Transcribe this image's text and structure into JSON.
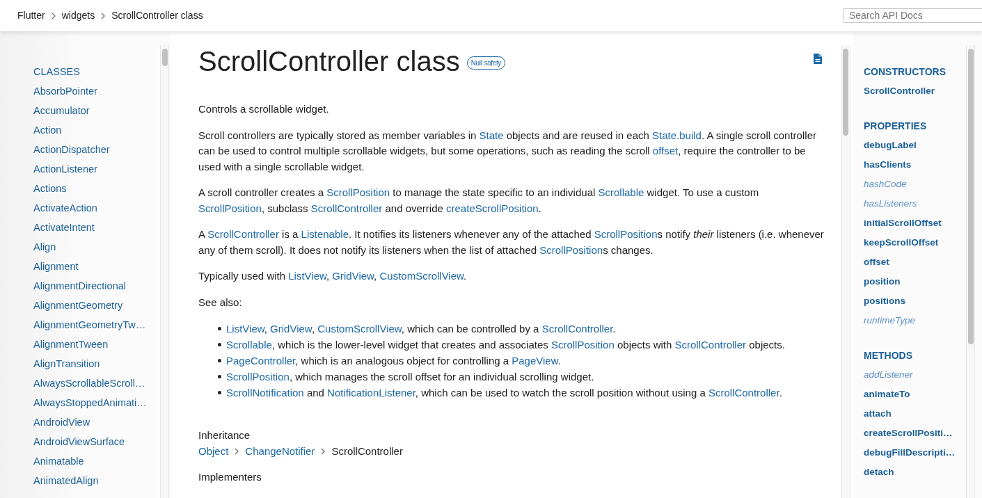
{
  "breadcrumbs": [
    {
      "label": "Flutter"
    },
    {
      "label": "widgets"
    },
    {
      "label": "ScrollController class"
    }
  ],
  "search": {
    "placeholder": "Search API Docs"
  },
  "left_sidebar": {
    "heading": "CLASSES",
    "items": [
      "AbsorbPointer",
      "Accumulator",
      "Action",
      "ActionDispatcher",
      "ActionListener",
      "Actions",
      "ActivateAction",
      "ActivateIntent",
      "Align",
      "Alignment",
      "AlignmentDirectional",
      "AlignmentGeometry",
      "AlignmentGeometryTw…",
      "AlignmentTween",
      "AlignTransition",
      "AlwaysScrollableScroll…",
      "AlwaysStoppedAnimati…",
      "AndroidView",
      "AndroidViewSurface",
      "Animatable",
      "AnimatedAlign"
    ]
  },
  "main": {
    "title": "ScrollController class",
    "badge": "Null safety",
    "paragraphs": [
      [
        {
          "kind": "text",
          "text": "Controls a scrollable widget."
        }
      ],
      [
        {
          "kind": "text",
          "text": "Scroll controllers are typically stored as member variables in "
        },
        {
          "kind": "link",
          "text": "State"
        },
        {
          "kind": "text",
          "text": " objects and are reused in each "
        },
        {
          "kind": "link",
          "text": "State.build"
        },
        {
          "kind": "text",
          "text": ". A single scroll controller can be used to control multiple scrollable widgets, but some operations, such as reading the scroll "
        },
        {
          "kind": "link",
          "text": "offset"
        },
        {
          "kind": "text",
          "text": ", require the controller to be used with a single scrollable widget."
        }
      ],
      [
        {
          "kind": "text",
          "text": "A scroll controller creates a "
        },
        {
          "kind": "link",
          "text": "ScrollPosition"
        },
        {
          "kind": "text",
          "text": " to manage the state specific to an individual "
        },
        {
          "kind": "link",
          "text": "Scrollable"
        },
        {
          "kind": "text",
          "text": " widget. To use a custom "
        },
        {
          "kind": "link",
          "text": "ScrollPosition"
        },
        {
          "kind": "text",
          "text": ", subclass "
        },
        {
          "kind": "link",
          "text": "ScrollController"
        },
        {
          "kind": "text",
          "text": " and override "
        },
        {
          "kind": "link",
          "text": "createScrollPosition"
        },
        {
          "kind": "text",
          "text": "."
        }
      ],
      [
        {
          "kind": "text",
          "text": "A "
        },
        {
          "kind": "link",
          "text": "ScrollController"
        },
        {
          "kind": "text",
          "text": " is a "
        },
        {
          "kind": "link",
          "text": "Listenable"
        },
        {
          "kind": "text",
          "text": ". It notifies its listeners whenever any of the attached "
        },
        {
          "kind": "link",
          "text": "ScrollPosition"
        },
        {
          "kind": "text",
          "text": "s notify *their* listeners (i.e. whenever any of them scroll). It does not notify its listeners when the list of attached "
        },
        {
          "kind": "link",
          "text": "ScrollPosition"
        },
        {
          "kind": "text",
          "text": "s changes."
        }
      ],
      [
        {
          "kind": "text",
          "text": "Typically used with "
        },
        {
          "kind": "link",
          "text": "ListView"
        },
        {
          "kind": "text",
          "text": ", "
        },
        {
          "kind": "link",
          "text": "GridView"
        },
        {
          "kind": "text",
          "text": ", "
        },
        {
          "kind": "link",
          "text": "CustomScrollView"
        },
        {
          "kind": "text",
          "text": "."
        }
      ],
      [
        {
          "kind": "text",
          "text": "See also:"
        }
      ]
    ],
    "see_also": [
      [
        {
          "kind": "link",
          "text": "ListView"
        },
        {
          "kind": "text",
          "text": ", "
        },
        {
          "kind": "link",
          "text": "GridView"
        },
        {
          "kind": "text",
          "text": ", "
        },
        {
          "kind": "link",
          "text": "CustomScrollView"
        },
        {
          "kind": "text",
          "text": ", which can be controlled by a "
        },
        {
          "kind": "link",
          "text": "ScrollController"
        },
        {
          "kind": "text",
          "text": "."
        }
      ],
      [
        {
          "kind": "link",
          "text": "Scrollable"
        },
        {
          "kind": "text",
          "text": ", which is the lower-level widget that creates and associates "
        },
        {
          "kind": "link",
          "text": "ScrollPosition"
        },
        {
          "kind": "text",
          "text": " objects with "
        },
        {
          "kind": "link",
          "text": "ScrollController"
        },
        {
          "kind": "text",
          "text": " objects."
        }
      ],
      [
        {
          "kind": "link",
          "text": "PageController"
        },
        {
          "kind": "text",
          "text": ", which is an analogous object for controlling a "
        },
        {
          "kind": "link",
          "text": "PageView"
        },
        {
          "kind": "text",
          "text": "."
        }
      ],
      [
        {
          "kind": "link",
          "text": "ScrollPosition"
        },
        {
          "kind": "text",
          "text": ", which manages the scroll offset for an individual scrolling widget."
        }
      ],
      [
        {
          "kind": "link",
          "text": "ScrollNotification"
        },
        {
          "kind": "text",
          "text": " and "
        },
        {
          "kind": "link",
          "text": "NotificationListener"
        },
        {
          "kind": "text",
          "text": ", which can be used to watch the scroll position without using a "
        },
        {
          "kind": "link",
          "text": "ScrollController"
        },
        {
          "kind": "text",
          "text": "."
        }
      ]
    ],
    "inheritance": {
      "label": "Inheritance",
      "chain": [
        {
          "kind": "link",
          "text": "Object"
        },
        {
          "kind": "link",
          "text": "ChangeNotifier"
        },
        {
          "kind": "text",
          "text": "ScrollController"
        }
      ]
    },
    "implementers_label": "Implementers"
  },
  "right_sidebar": {
    "sections": [
      {
        "heading": "CONSTRUCTORS",
        "items": [
          {
            "label": "ScrollController",
            "inherited": false
          }
        ]
      },
      {
        "heading": "PROPERTIES",
        "items": [
          {
            "label": "debugLabel",
            "inherited": false
          },
          {
            "label": "hasClients",
            "inherited": false
          },
          {
            "label": "hashCode",
            "inherited": true
          },
          {
            "label": "hasListeners",
            "inherited": true
          },
          {
            "label": "initialScrollOffset",
            "inherited": false
          },
          {
            "label": "keepScrollOffset",
            "inherited": false
          },
          {
            "label": "offset",
            "inherited": false
          },
          {
            "label": "position",
            "inherited": false
          },
          {
            "label": "positions",
            "inherited": false
          },
          {
            "label": "runtimeType",
            "inherited": true
          }
        ]
      },
      {
        "heading": "METHODS",
        "items": [
          {
            "label": "addListener",
            "inherited": true
          },
          {
            "label": "animateTo",
            "inherited": false
          },
          {
            "label": "attach",
            "inherited": false
          },
          {
            "label": "createScrollPositi…",
            "inherited": false
          },
          {
            "label": "debugFillDescripti…",
            "inherited": false
          },
          {
            "label": "detach",
            "inherited": false
          }
        ]
      }
    ]
  }
}
